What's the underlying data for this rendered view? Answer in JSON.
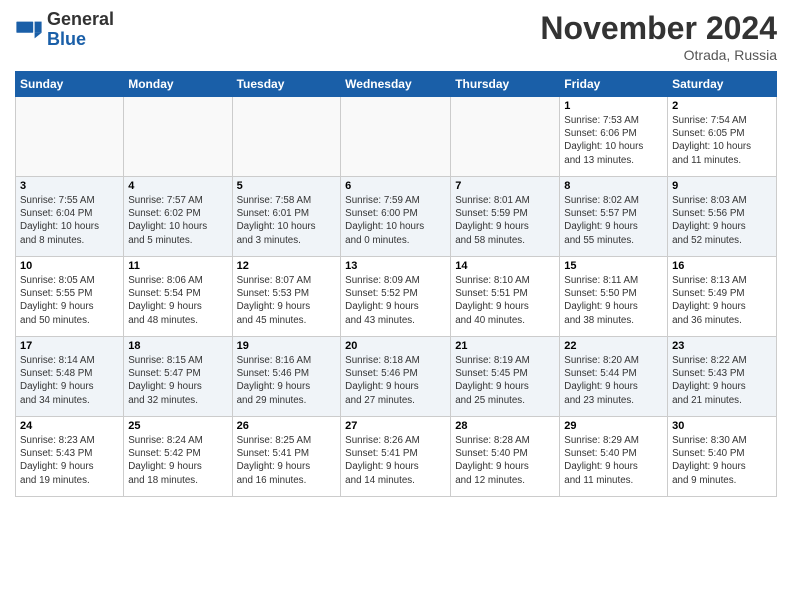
{
  "header": {
    "logo_general": "General",
    "logo_blue": "Blue",
    "month_title": "November 2024",
    "location": "Otrada, Russia"
  },
  "weekdays": [
    "Sunday",
    "Monday",
    "Tuesday",
    "Wednesday",
    "Thursday",
    "Friday",
    "Saturday"
  ],
  "weeks": [
    [
      {
        "day": "",
        "info": ""
      },
      {
        "day": "",
        "info": ""
      },
      {
        "day": "",
        "info": ""
      },
      {
        "day": "",
        "info": ""
      },
      {
        "day": "",
        "info": ""
      },
      {
        "day": "1",
        "info": "Sunrise: 7:53 AM\nSunset: 6:06 PM\nDaylight: 10 hours\nand 13 minutes."
      },
      {
        "day": "2",
        "info": "Sunrise: 7:54 AM\nSunset: 6:05 PM\nDaylight: 10 hours\nand 11 minutes."
      }
    ],
    [
      {
        "day": "3",
        "info": "Sunrise: 7:55 AM\nSunset: 6:04 PM\nDaylight: 10 hours\nand 8 minutes."
      },
      {
        "day": "4",
        "info": "Sunrise: 7:57 AM\nSunset: 6:02 PM\nDaylight: 10 hours\nand 5 minutes."
      },
      {
        "day": "5",
        "info": "Sunrise: 7:58 AM\nSunset: 6:01 PM\nDaylight: 10 hours\nand 3 minutes."
      },
      {
        "day": "6",
        "info": "Sunrise: 7:59 AM\nSunset: 6:00 PM\nDaylight: 10 hours\nand 0 minutes."
      },
      {
        "day": "7",
        "info": "Sunrise: 8:01 AM\nSunset: 5:59 PM\nDaylight: 9 hours\nand 58 minutes."
      },
      {
        "day": "8",
        "info": "Sunrise: 8:02 AM\nSunset: 5:57 PM\nDaylight: 9 hours\nand 55 minutes."
      },
      {
        "day": "9",
        "info": "Sunrise: 8:03 AM\nSunset: 5:56 PM\nDaylight: 9 hours\nand 52 minutes."
      }
    ],
    [
      {
        "day": "10",
        "info": "Sunrise: 8:05 AM\nSunset: 5:55 PM\nDaylight: 9 hours\nand 50 minutes."
      },
      {
        "day": "11",
        "info": "Sunrise: 8:06 AM\nSunset: 5:54 PM\nDaylight: 9 hours\nand 48 minutes."
      },
      {
        "day": "12",
        "info": "Sunrise: 8:07 AM\nSunset: 5:53 PM\nDaylight: 9 hours\nand 45 minutes."
      },
      {
        "day": "13",
        "info": "Sunrise: 8:09 AM\nSunset: 5:52 PM\nDaylight: 9 hours\nand 43 minutes."
      },
      {
        "day": "14",
        "info": "Sunrise: 8:10 AM\nSunset: 5:51 PM\nDaylight: 9 hours\nand 40 minutes."
      },
      {
        "day": "15",
        "info": "Sunrise: 8:11 AM\nSunset: 5:50 PM\nDaylight: 9 hours\nand 38 minutes."
      },
      {
        "day": "16",
        "info": "Sunrise: 8:13 AM\nSunset: 5:49 PM\nDaylight: 9 hours\nand 36 minutes."
      }
    ],
    [
      {
        "day": "17",
        "info": "Sunrise: 8:14 AM\nSunset: 5:48 PM\nDaylight: 9 hours\nand 34 minutes."
      },
      {
        "day": "18",
        "info": "Sunrise: 8:15 AM\nSunset: 5:47 PM\nDaylight: 9 hours\nand 32 minutes."
      },
      {
        "day": "19",
        "info": "Sunrise: 8:16 AM\nSunset: 5:46 PM\nDaylight: 9 hours\nand 29 minutes."
      },
      {
        "day": "20",
        "info": "Sunrise: 8:18 AM\nSunset: 5:46 PM\nDaylight: 9 hours\nand 27 minutes."
      },
      {
        "day": "21",
        "info": "Sunrise: 8:19 AM\nSunset: 5:45 PM\nDaylight: 9 hours\nand 25 minutes."
      },
      {
        "day": "22",
        "info": "Sunrise: 8:20 AM\nSunset: 5:44 PM\nDaylight: 9 hours\nand 23 minutes."
      },
      {
        "day": "23",
        "info": "Sunrise: 8:22 AM\nSunset: 5:43 PM\nDaylight: 9 hours\nand 21 minutes."
      }
    ],
    [
      {
        "day": "24",
        "info": "Sunrise: 8:23 AM\nSunset: 5:43 PM\nDaylight: 9 hours\nand 19 minutes."
      },
      {
        "day": "25",
        "info": "Sunrise: 8:24 AM\nSunset: 5:42 PM\nDaylight: 9 hours\nand 18 minutes."
      },
      {
        "day": "26",
        "info": "Sunrise: 8:25 AM\nSunset: 5:41 PM\nDaylight: 9 hours\nand 16 minutes."
      },
      {
        "day": "27",
        "info": "Sunrise: 8:26 AM\nSunset: 5:41 PM\nDaylight: 9 hours\nand 14 minutes."
      },
      {
        "day": "28",
        "info": "Sunrise: 8:28 AM\nSunset: 5:40 PM\nDaylight: 9 hours\nand 12 minutes."
      },
      {
        "day": "29",
        "info": "Sunrise: 8:29 AM\nSunset: 5:40 PM\nDaylight: 9 hours\nand 11 minutes."
      },
      {
        "day": "30",
        "info": "Sunrise: 8:30 AM\nSunset: 5:40 PM\nDaylight: 9 hours\nand 9 minutes."
      }
    ]
  ]
}
